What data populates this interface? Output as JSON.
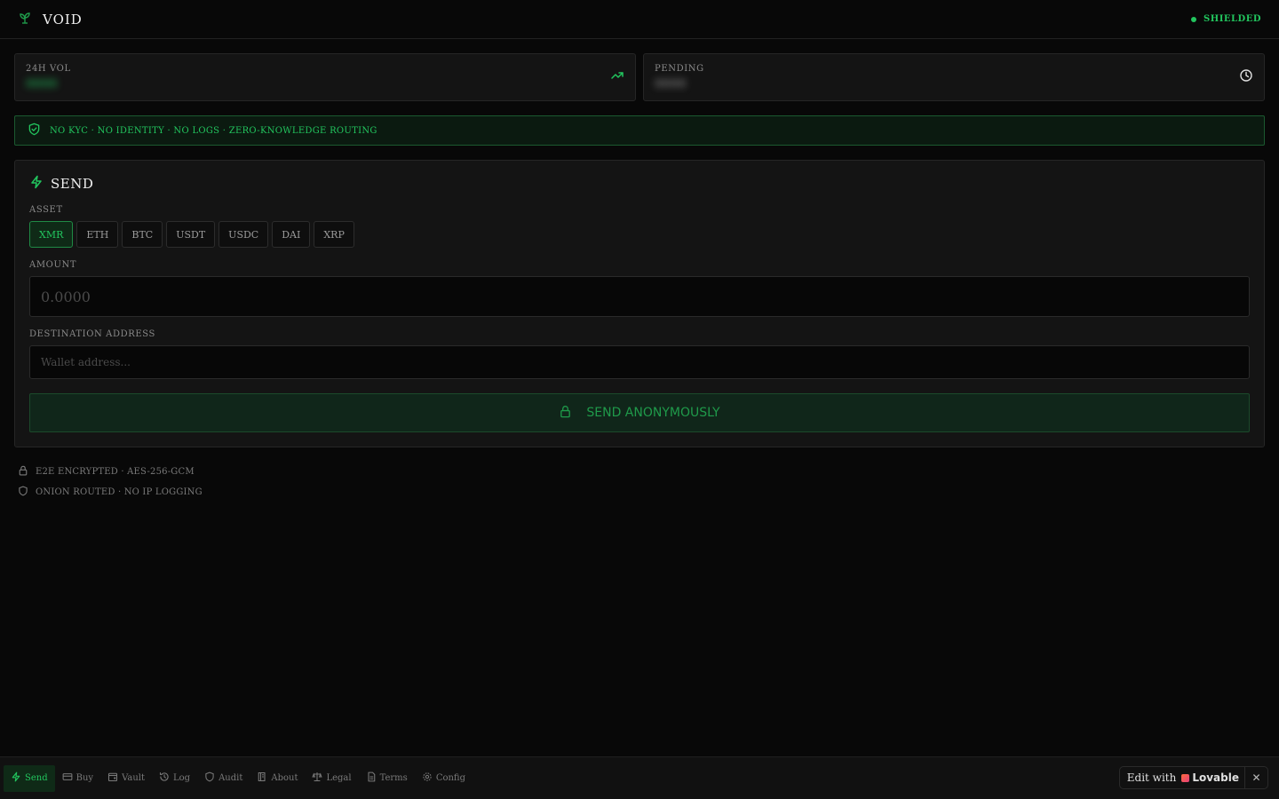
{
  "header": {
    "brand_name": "VOID",
    "status_label": "SHIELDED",
    "logo_icon": "leaf-icon"
  },
  "stats": [
    {
      "label": "24H VOL",
      "value": "0000",
      "icon": "trending-up-icon"
    },
    {
      "label": "PENDING",
      "value": "0000",
      "icon": "clock-icon"
    }
  ],
  "banner": {
    "text": "NO KYC · NO IDENTITY · NO LOGS · ZERO-KNOWLEDGE ROUTING",
    "icon": "shield-check-icon"
  },
  "send_panel": {
    "title": "SEND",
    "asset_label": "ASSET",
    "assets": [
      "XMR",
      "ETH",
      "BTC",
      "USDT",
      "USDC",
      "DAI",
      "XRP"
    ],
    "selected_asset": "XMR",
    "amount_label": "AMOUNT",
    "amount_placeholder": "0.0000",
    "address_label": "DESTINATION ADDRESS",
    "address_placeholder": "Wallet address...",
    "submit_label": "SEND ANONYMOUSLY"
  },
  "notes": [
    {
      "text": "E2E ENCRYPTED · AES-256-GCM",
      "icon": "lock-icon"
    },
    {
      "text": "ONION ROUTED · NO IP LOGGING",
      "icon": "shield-icon"
    }
  ],
  "nav": {
    "items": [
      {
        "label": "Send",
        "icon": "zap-icon",
        "active": true
      },
      {
        "label": "Buy",
        "icon": "card-icon"
      },
      {
        "label": "Vault",
        "icon": "wallet-icon"
      },
      {
        "label": "Log",
        "icon": "history-icon"
      },
      {
        "label": "Audit",
        "icon": "shield-icon"
      },
      {
        "label": "About",
        "icon": "book-icon"
      },
      {
        "label": "Legal",
        "icon": "scale-icon"
      },
      {
        "label": "Terms",
        "icon": "file-icon"
      },
      {
        "label": "Config",
        "icon": "gear-icon"
      }
    ]
  },
  "lovable": {
    "prefix": "Edit with",
    "brand": "Lovable",
    "close": "✕"
  },
  "colors": {
    "accent": "#22c55e",
    "background": "#080808",
    "panel": "#141414"
  }
}
